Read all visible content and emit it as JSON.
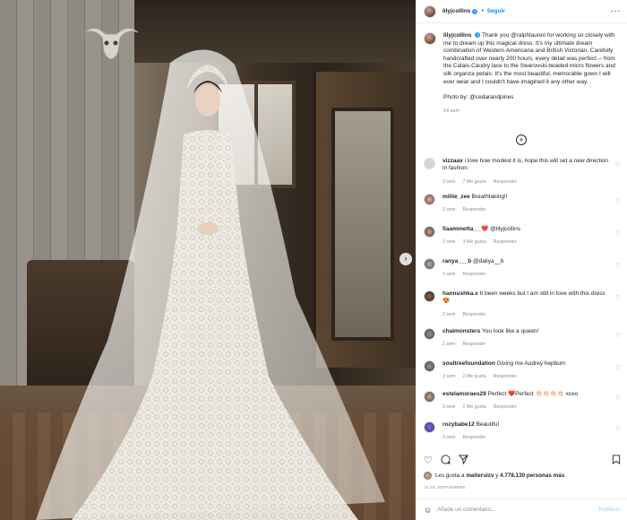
{
  "post": {
    "username": "lilyjcollins",
    "follow_label": "Seguir",
    "verified": true,
    "more_icon": "more-horizontal-icon"
  },
  "caption": {
    "username": "lilyjcollins",
    "text": "Thank you @ralphlauren for working so closely with me to dream up this magical dress. It's my ultimate dream combination of Western Americana and British Victorian. Carefully handcrafted over nearly 200 hours, every detail was perfect -- from the Calais-Caudry lace to the Swarovski-beaded micro flowers and silk organza petals. It's the most beautiful, memorable gown I will ever wear and I couldn't have imagined it any other way...",
    "credit": "Photo by: @cedarandpines",
    "age": "14 sem"
  },
  "comments": [
    {
      "username": "vizzaav",
      "text": "i love how modest it is, hope this will set a new direction in fashion",
      "age": "3 sem",
      "likes": "7 Me gusta",
      "reply": "Responder"
    },
    {
      "username": "millie_zee",
      "text": "Breathtaking!!",
      "age": "3 sem",
      "likes": "",
      "reply": "Responder"
    },
    {
      "username": "fiaammetta__",
      "text": "❤️ @lilyjcollins",
      "age": "3 sem",
      "likes": "3 Me gusta",
      "reply": "Responder"
    },
    {
      "username": "ranya___b",
      "text": "@daliya__b",
      "age": "3 sem",
      "likes": "",
      "reply": "Responder"
    },
    {
      "username": "hannushka.x",
      "text": "It been weeks but I am still in love with this dress😍",
      "age": "2 sem",
      "likes": "",
      "reply": "Responder"
    },
    {
      "username": "chaimonsters",
      "text": "You look like a queen!",
      "age": "2 sem",
      "likes": "",
      "reply": "Responder"
    },
    {
      "username": "soultreefoundation",
      "text": "Giving me Audrey hepburn",
      "age": "3 sem",
      "likes": "2 Me gusta",
      "reply": "Responder"
    },
    {
      "username": "estelamoraes29",
      "text": "Perfect ❤️Perfect 👏🏻👏🏻👏🏻👏🏻 xoxo",
      "age": "3 sem",
      "likes": "1 Me gusta",
      "reply": "Responder"
    },
    {
      "username": "rozybabe12",
      "text": "Beautiful",
      "age": "3 sem",
      "likes": "",
      "reply": "Responder"
    }
  ],
  "actions": {
    "like_icon": "heart-icon",
    "comment_icon": "comment-icon",
    "share_icon": "send-icon",
    "save_icon": "bookmark-icon"
  },
  "likes": {
    "prefix": "Les gusta a",
    "user": "maiteruizv",
    "conjunction": "y",
    "count": "4.778.130 personas más"
  },
  "date": "15 DE SEPTIEMBRE",
  "add_comment": {
    "placeholder": "Añade un comentario...",
    "post_label": "Publicar"
  }
}
